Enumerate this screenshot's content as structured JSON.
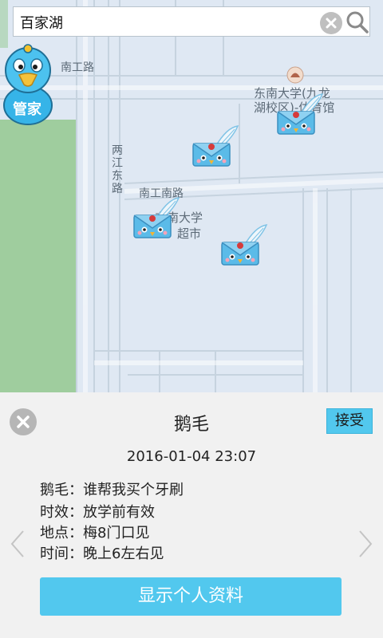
{
  "search": {
    "value": "百家湖",
    "placeholder": ""
  },
  "mascot": {
    "label": "管家"
  },
  "map": {
    "labels": {
      "road_nangong": "南工路",
      "road_liangjiang_1": "两",
      "road_liangjiang_2": "江",
      "road_liangjiang_3": "东",
      "road_liangjiang_4": "路",
      "road_nangongnan": "南工南路",
      "poi_seu_line1": "东南大学(九龙",
      "poi_seu_line2": "湖校区)-体育馆",
      "poi_market_line1": "东南大学",
      "poi_market_line2": "超市"
    }
  },
  "panel": {
    "title": "鹅毛",
    "accept_label": "接受",
    "datetime": "2016-01-04 23:07",
    "details": [
      {
        "key": "鹅毛",
        "value": "谁帮我买个牙刷"
      },
      {
        "key": "时效",
        "value": "放学前有效"
      },
      {
        "key": "地点",
        "value": "梅8门口见"
      },
      {
        "key": "时间",
        "value": "晚上6左右见"
      }
    ],
    "details_text": [
      "鹅毛：谁帮我买个牙刷",
      "时效：放学前有效",
      "地点：梅8门口见",
      "时间：晚上6左右见"
    ],
    "profile_button_label": "显示个人资料"
  },
  "colors": {
    "accent": "#52c8ee",
    "map_background": "#dfe8f3",
    "green_area": "#9fcd9e",
    "panel_background": "#f1f1f1"
  },
  "icons": {
    "clear": "clear-x-icon",
    "search": "magnifier-icon",
    "pin": "envelope-feather-icon",
    "close": "close-x-icon",
    "prev": "chevron-left-icon",
    "next": "chevron-right-icon"
  }
}
